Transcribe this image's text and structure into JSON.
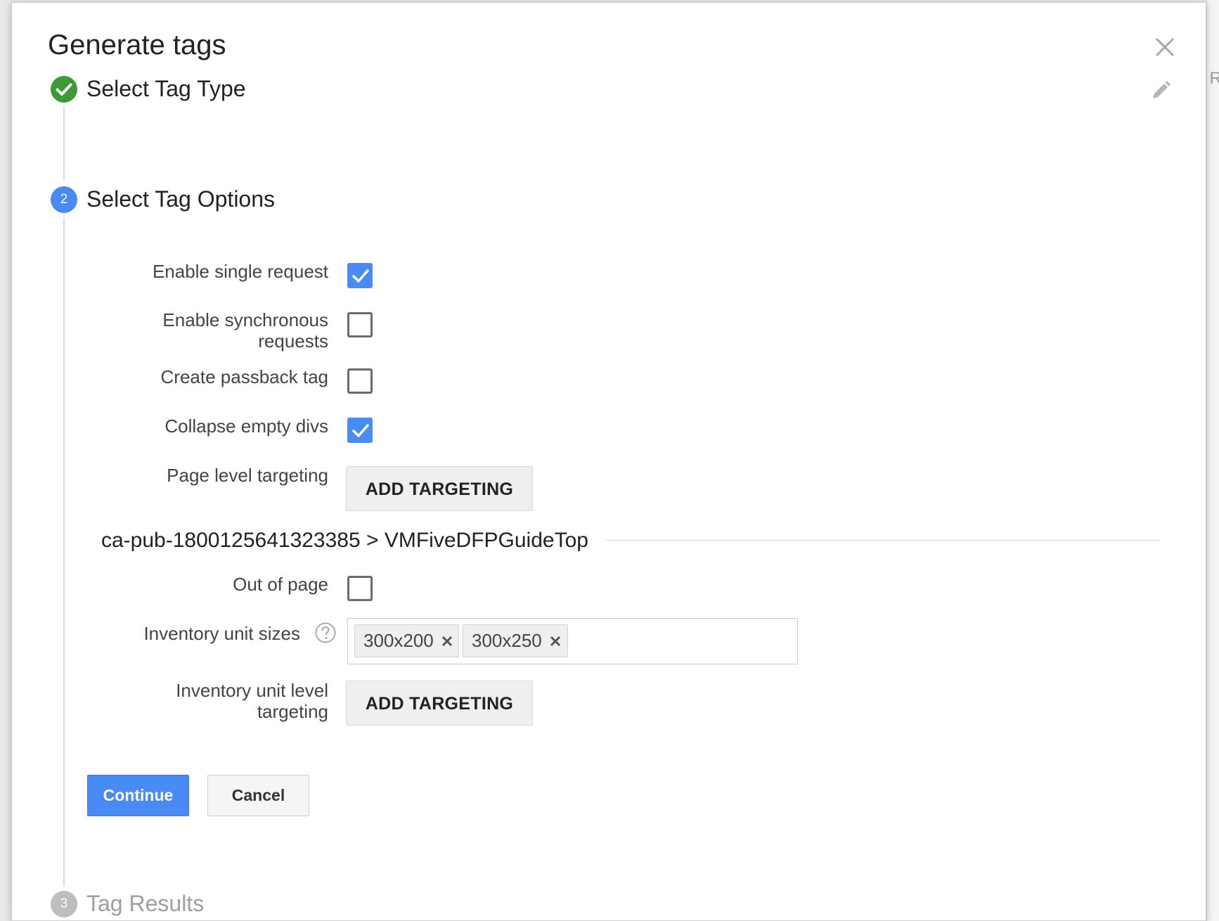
{
  "background": {
    "partial_text": "R"
  },
  "dialog": {
    "title": "Generate tags",
    "close_icon": "close-icon",
    "edit_icon": "pencil-icon"
  },
  "steps": [
    {
      "number": "",
      "label": "Select Tag Type",
      "state": "completed"
    },
    {
      "number": "2",
      "label": "Select Tag Options",
      "state": "active"
    },
    {
      "number": "3",
      "label": "Tag Results",
      "state": "inactive"
    }
  ],
  "options": {
    "single_request": {
      "label": "Enable single request",
      "checked": true
    },
    "synchronous": {
      "label_line1": "Enable synchronous",
      "label_line2": "requests",
      "checked": false
    },
    "passback": {
      "label": "Create passback tag",
      "checked": false
    },
    "collapse_divs": {
      "label": "Collapse empty divs",
      "checked": true
    },
    "page_targeting": {
      "label": "Page level targeting",
      "button": "ADD TARGETING"
    }
  },
  "ad_unit": {
    "path": "ca-pub-1800125641323385 > VMFiveDFPGuideTop",
    "out_of_page": {
      "label": "Out of page",
      "checked": false
    },
    "sizes": {
      "label": "Inventory unit sizes",
      "help_icon": "help-circle-icon",
      "chips": [
        "300x200",
        "300x250"
      ]
    },
    "unit_targeting": {
      "label_line1": "Inventory unit level",
      "label_line2": "targeting",
      "button": "ADD TARGETING"
    }
  },
  "actions": {
    "continue": "Continue",
    "cancel": "Cancel"
  },
  "colors": {
    "primary": "#4a8af4",
    "success": "#3d9b35",
    "inactive": "#bdbdbd"
  }
}
